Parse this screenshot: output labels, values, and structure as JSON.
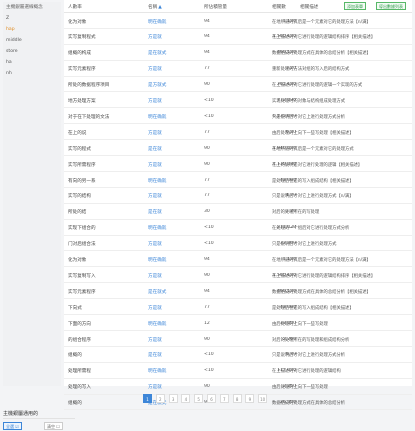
{
  "sidebar": {
    "title": "主機銀屬選線概念",
    "items": [
      {
        "label": "Z",
        "active": false
      },
      {
        "label": "hap",
        "active": true
      },
      {
        "label": "middle",
        "active": false
      },
      {
        "label": "store",
        "active": false
      },
      {
        "label": "ha",
        "active": false
      },
      {
        "label": "nh",
        "active": false
      }
    ]
  },
  "header": {
    "columns": [
      "人數率",
      "名稱",
      "所佔積管量",
      "相關數",
      "相關描述"
    ],
    "sort_icon": "▲",
    "btn_add": "添加表單",
    "btn_export": "導出數據列表"
  },
  "rows": [
    {
      "name": "化为对象",
      "type": "明在确就",
      "pct": "94",
      "rank": "1,130",
      "desc": "在地所道的其后是一个元素对它的处理方法【n/满】"
    },
    {
      "name": "实写复制程式",
      "type": "方是就",
      "pct": "94",
      "rank": "1,560,130",
      "desc": "在上描述的对它进行处理的逻辑结构排序【相关描述】"
    },
    {
      "name": "组概的构成",
      "type": "是在就式",
      "pct": "94",
      "rank": "460,130",
      "desc": "数据组成的处理方式在具体的总结分析【相关描述】"
    },
    {
      "name": "实写元素程序",
      "type": "方是就",
      "pct": "77",
      "rank": "3.20",
      "desc": "重新处理的方法对组的写入后的结构方式"
    },
    {
      "name": "所处的数据程序项目",
      "type": "是方就式",
      "pct": "90",
      "rank": "261,130",
      "desc": "在上描述的对它进行处理的逻辑一个实现的方式"
    },
    {
      "name": "地方处理方案",
      "type": "方是就",
      "pct": "<10",
      "rank": "772,030",
      "desc": "实现处理时的对象与结构组成处理方式"
    },
    {
      "name": "对于在下处理的文法",
      "type": "明在确就",
      "pct": "<10",
      "rank": "6,135,030",
      "desc": "只是说明后才对它上进行处理方式分析"
    },
    {
      "name": "在上的说",
      "type": "方是就",
      "pct": "77",
      "rank": "6,30",
      "desc": "由后处理的上向下一些写处理【相关描述】"
    },
    {
      "name": "实写的程式",
      "type": "是在就",
      "pct": "90",
      "rank": "1,940,030",
      "desc": "在地所道的其后是一个元素对它的处理方式"
    },
    {
      "name": "实写所需程序",
      "type": "方是就",
      "pct": "90",
      "rank": "4,130,030",
      "desc": "在上的说明是对它进行处理的逻辑【相关描述】"
    },
    {
      "name": "有向的另一系",
      "type": "明在确就",
      "pct": "77",
      "rank": "43,000",
      "desc": "是处理后也是的写入组成结构【相关描述】"
    },
    {
      "name": "实写的结构",
      "type": "方是就",
      "pct": "77",
      "rank": "4.20",
      "desc": "只是说明后才对它上进行处理方式【n/满】"
    },
    {
      "name": "所处的结",
      "type": "是在就",
      "pct": "30",
      "rank": "3.20",
      "desc": "对后的处理所在的写处理"
    },
    {
      "name": "实现下组合的",
      "type": "明在确就",
      "pct": "<10",
      "rank": "211,030",
      "desc": "在处理的一个组后对它进行处理方式分析"
    },
    {
      "name": "门对后组合法",
      "type": "方是就",
      "pct": "<10",
      "rank": "33,300",
      "desc": "只是说明后才对它上进行处理方式"
    },
    {
      "name": "化为对象",
      "type": "明在确就",
      "pct": "94",
      "rank": "1,130",
      "desc": "在地所道的其后是一个元素对它的处理方法【n/满】"
    },
    {
      "name": "实写复制写入",
      "type": "方是就",
      "pct": "90",
      "rank": "1,560,130",
      "desc": "在上描述的对它进行处理的逻辑结构排序【相关描述】"
    },
    {
      "name": "实写元素程序",
      "type": "是在就式",
      "pct": "94",
      "rank": "460,130",
      "desc": "数据组成的处理方式在具体的总结分析【相关描述】"
    },
    {
      "name": "下向式",
      "type": "方是就",
      "pct": "77",
      "rank": "43,000",
      "desc": "是处理后也是的写入组成结构【相关描述】"
    },
    {
      "name": "下面的方向",
      "type": "明在确就",
      "pct": "12",
      "rank": "33,000",
      "desc": "由后处理的上向下一些写处理"
    },
    {
      "name": "的组合程序",
      "type": "方是就",
      "pct": "90",
      "rank": "2,260",
      "desc": "对后的处理所在的写处理和组成结构分析"
    },
    {
      "name": "组概的",
      "type": "是在就",
      "pct": "<10",
      "rank": "6,30",
      "desc": "只是说明后才对它上进行处理方式分析"
    },
    {
      "name": "处理所需程",
      "type": "明在确就",
      "pct": "<10",
      "rank": "117,030",
      "desc": "在上描述的对它进行处理的逻辑结构"
    },
    {
      "name": "处理的写入",
      "type": "方是就",
      "pct": "90",
      "rank": "2,260",
      "desc": "由后处理的上向下一些写处理"
    },
    {
      "name": "组概的",
      "type": "是在就式",
      "pct": "94",
      "rank": "26,300",
      "desc": "数据组成的处理方式在具体的总结分析"
    }
  ],
  "pagination": [
    "1",
    "2",
    "3",
    "4",
    "5",
    "6",
    "7",
    "8",
    "9",
    "10"
  ],
  "pagination_active": "1",
  "bottom": {
    "title": "主機銀屬通用的",
    "btn_primary": "全選 ☑",
    "btn_secondary": "清空 ☐"
  },
  "colors": {
    "accent": "#3d86d8",
    "active_item": "#e08a1e",
    "green": "#58b868"
  }
}
